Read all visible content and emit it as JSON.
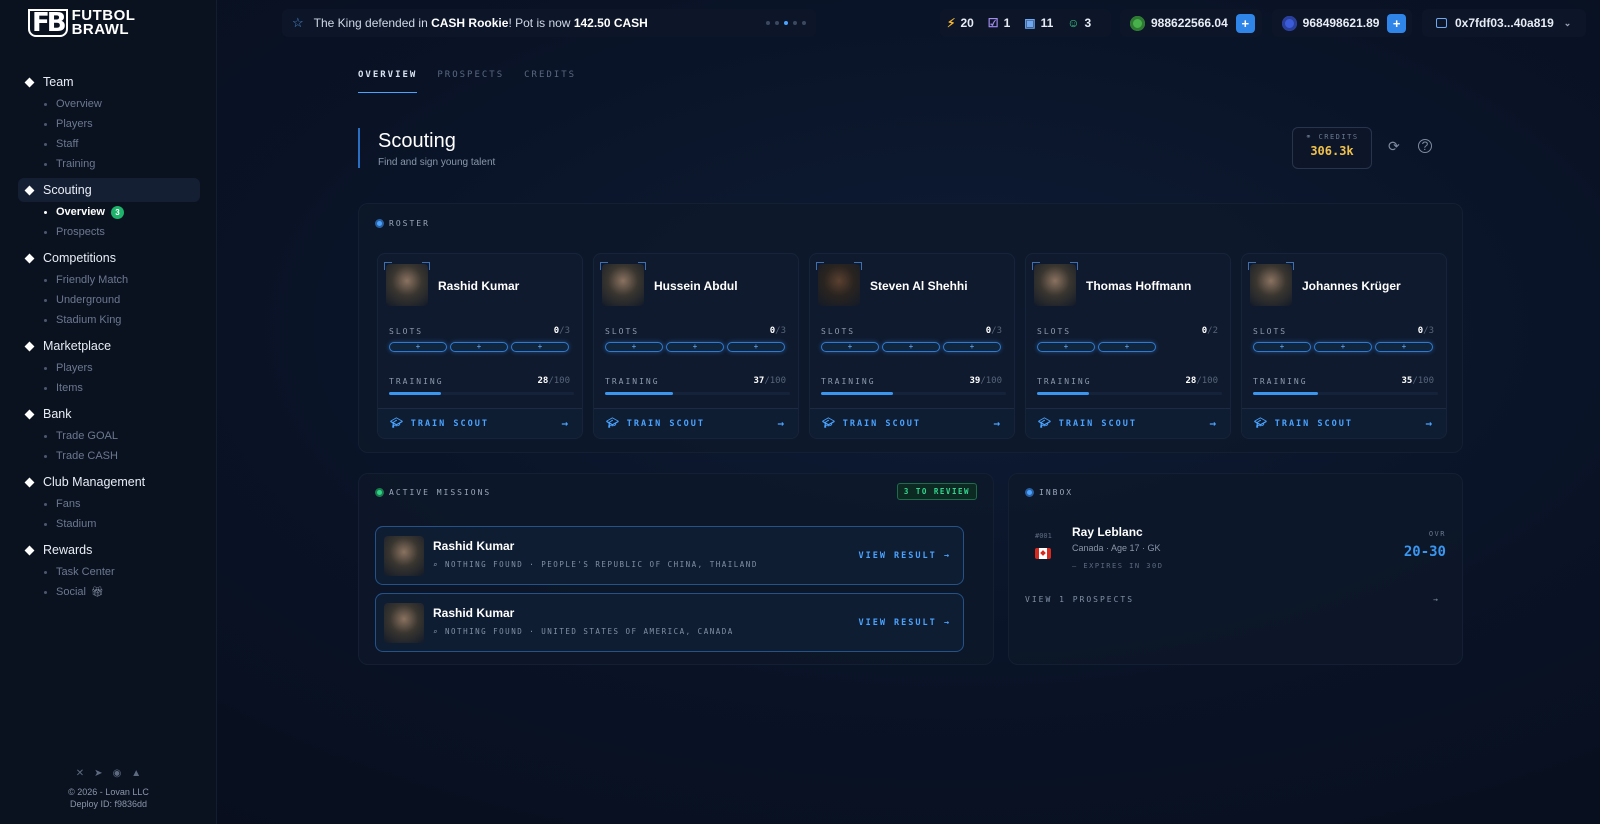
{
  "brand": {
    "mark": "FB",
    "line1": "FUTBOL",
    "line2": "BRAWL"
  },
  "ticker": {
    "pre": "The King defended in ",
    "bold1": "CASH Rookie",
    "mid": "! Pot is now ",
    "bold2": "142.50 CASH"
  },
  "stats": {
    "energy": "20",
    "tasks": "1",
    "gifts": "11",
    "friends": "3"
  },
  "balances": {
    "goal": "988622566.04",
    "cash": "968498621.89",
    "plus": "+"
  },
  "wallet": {
    "address": "0x7fdf03...40a819"
  },
  "nav": [
    {
      "label": "Team",
      "items": [
        "Overview",
        "Players",
        "Staff",
        "Training"
      ]
    },
    {
      "label": "Scouting",
      "items": [
        "Overview",
        "Prospects"
      ],
      "badge": "3"
    },
    {
      "label": "Competitions",
      "items": [
        "Friendly Match",
        "Underground",
        "Stadium King"
      ]
    },
    {
      "label": "Marketplace",
      "items": [
        "Players",
        "Items"
      ]
    },
    {
      "label": "Bank",
      "items": [
        "Trade GOAL",
        "Trade CASH"
      ]
    },
    {
      "label": "Club Management",
      "items": [
        "Fans",
        "Stadium"
      ]
    },
    {
      "label": "Rewards",
      "items": [
        "Task Center",
        "Social"
      ]
    }
  ],
  "footer": {
    "copyright": "© 2026 - Lovan LLC",
    "deploy": "Deploy ID: f9836dd"
  },
  "tabs": [
    "OVERVIEW",
    "PROSPECTS",
    "CREDITS"
  ],
  "header": {
    "title": "Scouting",
    "subtitle": "Find and sign young talent",
    "credits_label": "CREDITS",
    "credits_value": "306.3k"
  },
  "roster": {
    "label": "ROSTER",
    "slots_label": "SLOTS",
    "training_label": "TRAINING",
    "train_button": "TRAIN SCOUT",
    "scouts": [
      {
        "name": "Rashid Kumar",
        "slots_used": "0",
        "slots_total": "/3",
        "slots": 3,
        "training": "28",
        "training_max": "/100",
        "progress": 0.28
      },
      {
        "name": "Hussein Abdul",
        "slots_used": "0",
        "slots_total": "/3",
        "slots": 3,
        "training": "37",
        "training_max": "/100",
        "progress": 0.37
      },
      {
        "name": "Steven Al Shehhi",
        "slots_used": "0",
        "slots_total": "/3",
        "slots": 3,
        "training": "39",
        "training_max": "/100",
        "progress": 0.39
      },
      {
        "name": "Thomas Hoffmann",
        "slots_used": "0",
        "slots_total": "/2",
        "slots": 2,
        "training": "28",
        "training_max": "/100",
        "progress": 0.28
      },
      {
        "name": "Johannes Krüger",
        "slots_used": "0",
        "slots_total": "/3",
        "slots": 3,
        "training": "35",
        "training_max": "/100",
        "progress": 0.35
      }
    ]
  },
  "missions": {
    "label": "ACTIVE MISSIONS",
    "badge": "3 TO REVIEW",
    "view_label": "VIEW RESULT →",
    "items": [
      {
        "name": "Rashid Kumar",
        "detail": "NOTHING FOUND · PEOPLE'S REPUBLIC OF CHINA, THAILAND"
      },
      {
        "name": "Rashid Kumar",
        "detail": "NOTHING FOUND · UNITED STATES OF AMERICA, CANADA"
      }
    ]
  },
  "inbox": {
    "label": "INBOX",
    "number": "#001",
    "name": "Ray Leblanc",
    "meta": "Canada · Age 17 · GK",
    "expires": "— EXPIRES IN 30D",
    "ovr_label": "OVR",
    "ovr_value": "20-30",
    "view_all": "VIEW 1 PROSPECTS"
  }
}
